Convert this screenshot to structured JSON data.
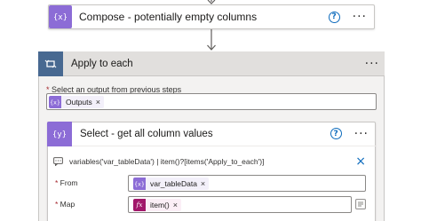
{
  "compose": {
    "title": "Compose - potentially empty columns",
    "help": "?",
    "more": "···"
  },
  "apply_to_each": {
    "title": "Apply to each",
    "more": "···",
    "select_label_required": "*",
    "select_label": " Select an output from previous steps",
    "output_token": "Outputs",
    "token_remove": "×"
  },
  "select_action": {
    "title": "Select - get all column values",
    "help": "?",
    "more": "···",
    "expression": "variables('var_tableData') | item()?[items('Apply_to_each')]",
    "close": "×",
    "from_label_required": "*",
    "from_label": " From",
    "from_token": "var_tableData",
    "map_label_required": "*",
    "map_label": " Map",
    "map_token": "item()",
    "fx_glyph": "fx",
    "token_remove": "×"
  },
  "colors": {
    "compose_tile": "#8c6cd6",
    "apply_tile": "#486991",
    "expression_tile": "#a1186a",
    "link_blue": "#0f6cbd"
  }
}
